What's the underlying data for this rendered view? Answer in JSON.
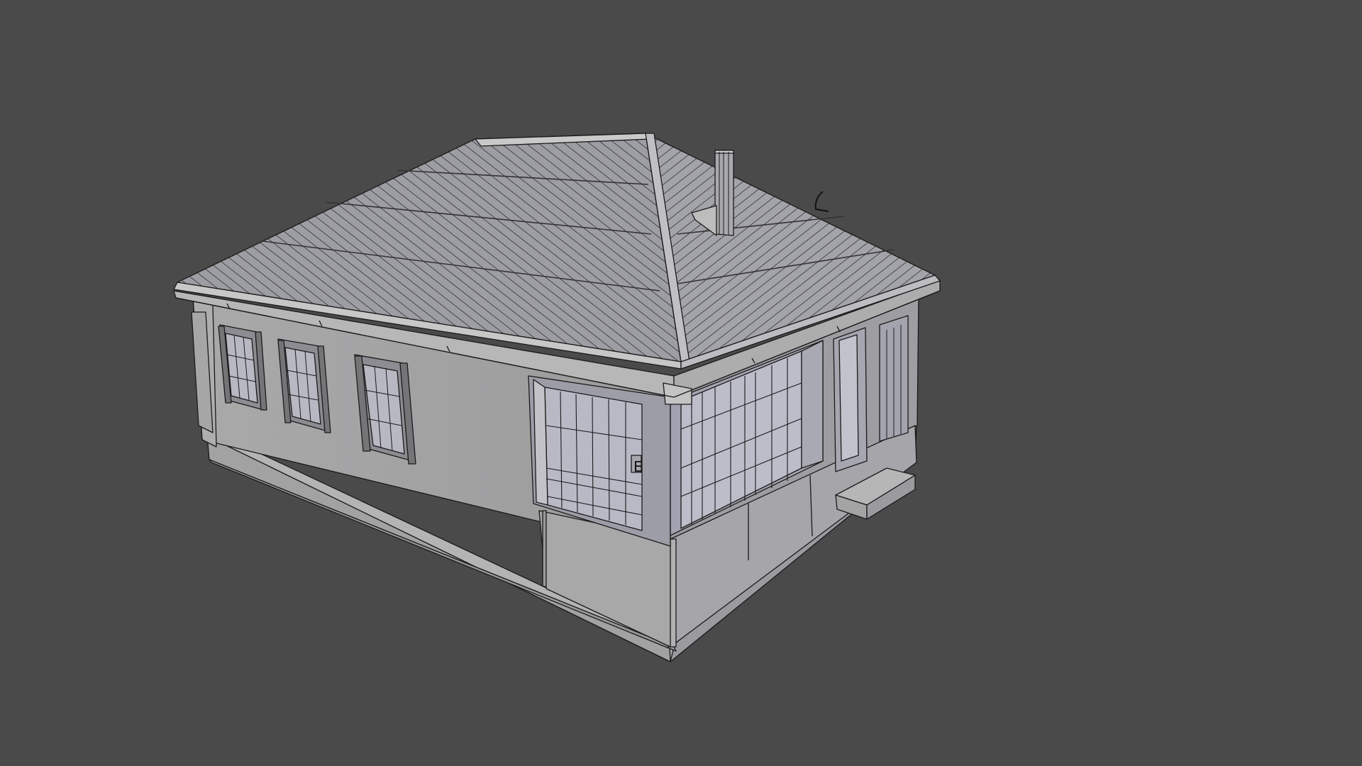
{
  "viewport": {
    "background_color": "#4a4a4a",
    "model": {
      "description_name": "house",
      "shading": "solid-with-wireframe",
      "face_color": "#a4a4a4",
      "edge_color": "#111111"
    }
  }
}
